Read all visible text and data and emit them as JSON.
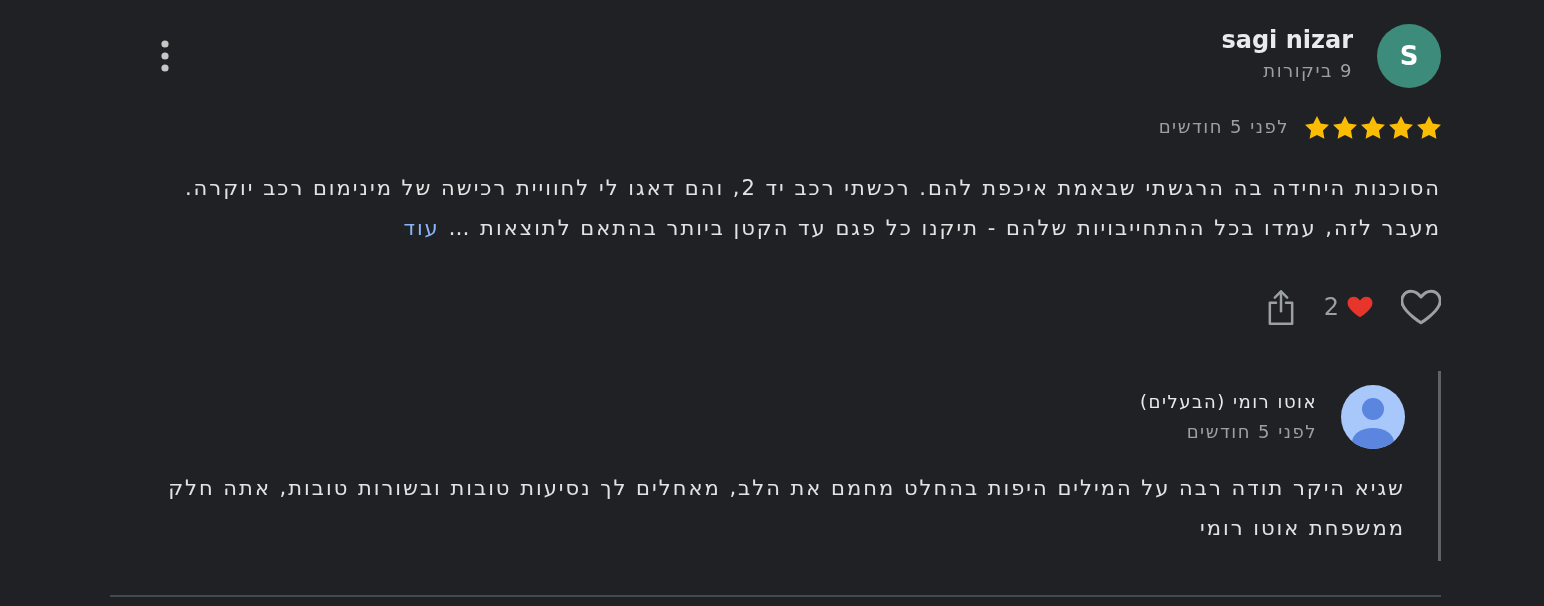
{
  "review": {
    "avatar_initial": "S",
    "author": "sagi nizar",
    "review_count": "9 ביקורות",
    "stars": 5,
    "date": "לפני 5 חודשים",
    "text": "הסוכנות היחידה בה הרגשתי שבאמת איכפת להם. רכשתי רכב יד 2, והם דאגו לי לחוויית רכישה של מינימום רכב יוקרה. מעבר לזה, עמדו בכל ההתחייבויות שלהם - תיקנו כל פגם עד הקטן ביותר בהתאם לתוצאות …",
    "more_link": "עוד",
    "liked": false,
    "reaction_count": "2"
  },
  "owner_reply": {
    "author": "אוטו רומי (הבעלים)",
    "date": "לפני 5 חודשים",
    "text": "שגיא היקר תודה רבה על המילים היפות בהחלט מחמם את הלב, מאחלים לך נסיעות טובות ובשורות טובות, אתה חלק ממשפחת אוטו רומי"
  }
}
